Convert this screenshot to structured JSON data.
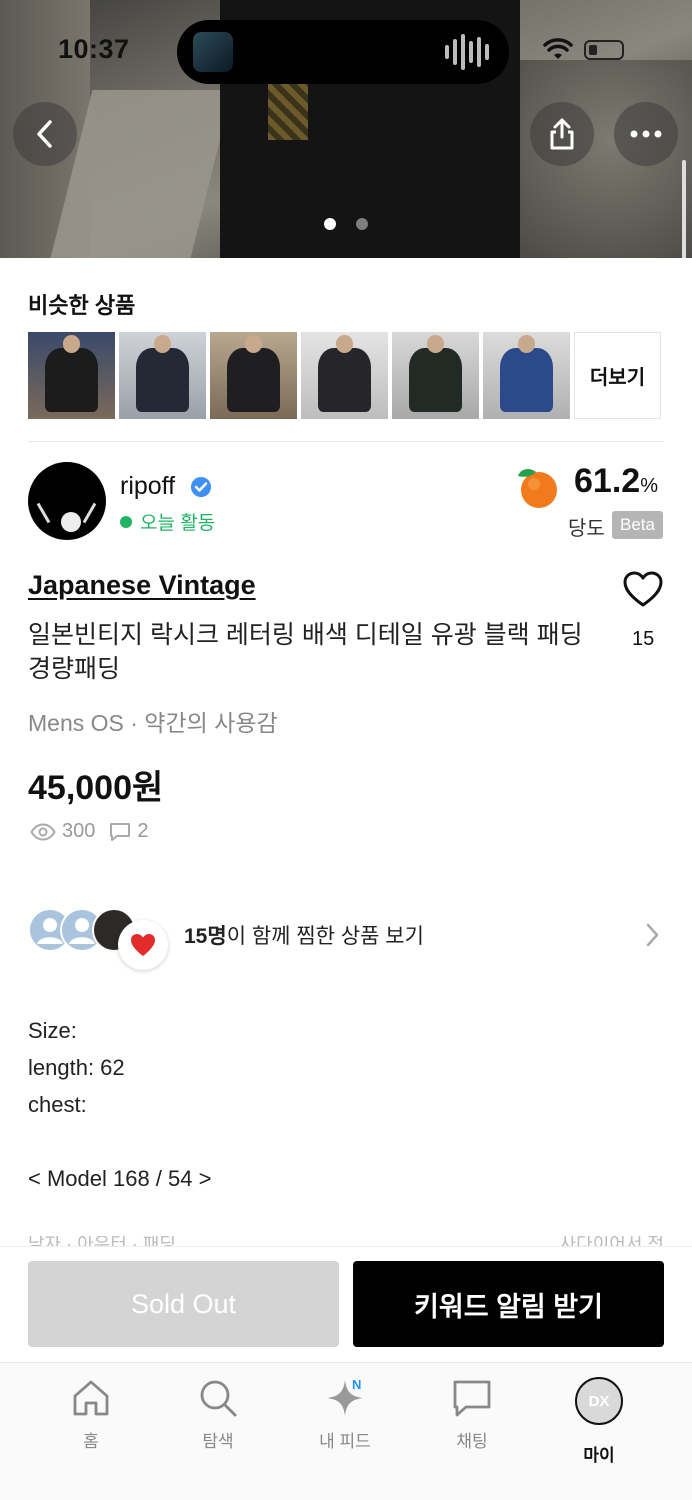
{
  "status_bar": {
    "time": "10:37"
  },
  "hero": {
    "total_images": 2,
    "active_index": 0
  },
  "similar": {
    "title": "비슷한 상품",
    "more_label": "더보기",
    "thumb_colors": [
      "#1c1c1c",
      "#232a36",
      "#1f1f22",
      "#26262a",
      "#222a26",
      "#2b4a8c"
    ]
  },
  "seller": {
    "name": "ripoff",
    "activity": "오늘 활동",
    "score_value": "61.2",
    "score_unit": "%",
    "score_label": "당도",
    "score_badge": "Beta"
  },
  "product": {
    "brand": "Japanese Vintage",
    "title": "일본빈티지 락시크 레터링 배색 디테일 유광 블랙 패딩 경량패딩",
    "meta": "Mens OS · 약간의 사용감",
    "price": "45,000원",
    "likes": "15",
    "views": "300",
    "comments": "2"
  },
  "wishers": {
    "count_text": "15명",
    "suffix_text": "이 함께 찜한 상품 보기"
  },
  "description": [
    "Size:",
    "length: 62",
    "chest:",
    "",
    "< Model 168 / 54 >"
  ],
  "description_cutoff": {
    "left": "남자 · 아우터 · 패딩",
    "right": "사다이어서 전"
  },
  "actions": {
    "sold_out": "Sold Out",
    "keyword_alert": "키워드 알림 받기"
  },
  "tabs": [
    {
      "label": "홈",
      "icon": "home-icon"
    },
    {
      "label": "탐색",
      "icon": "search-icon"
    },
    {
      "label": "내 피드",
      "icon": "sparkle-icon",
      "badge": "N"
    },
    {
      "label": "채팅",
      "icon": "chat-icon"
    },
    {
      "label": "마이",
      "icon": "profile-avatar",
      "avatar_text": "DX",
      "active": true
    }
  ]
}
